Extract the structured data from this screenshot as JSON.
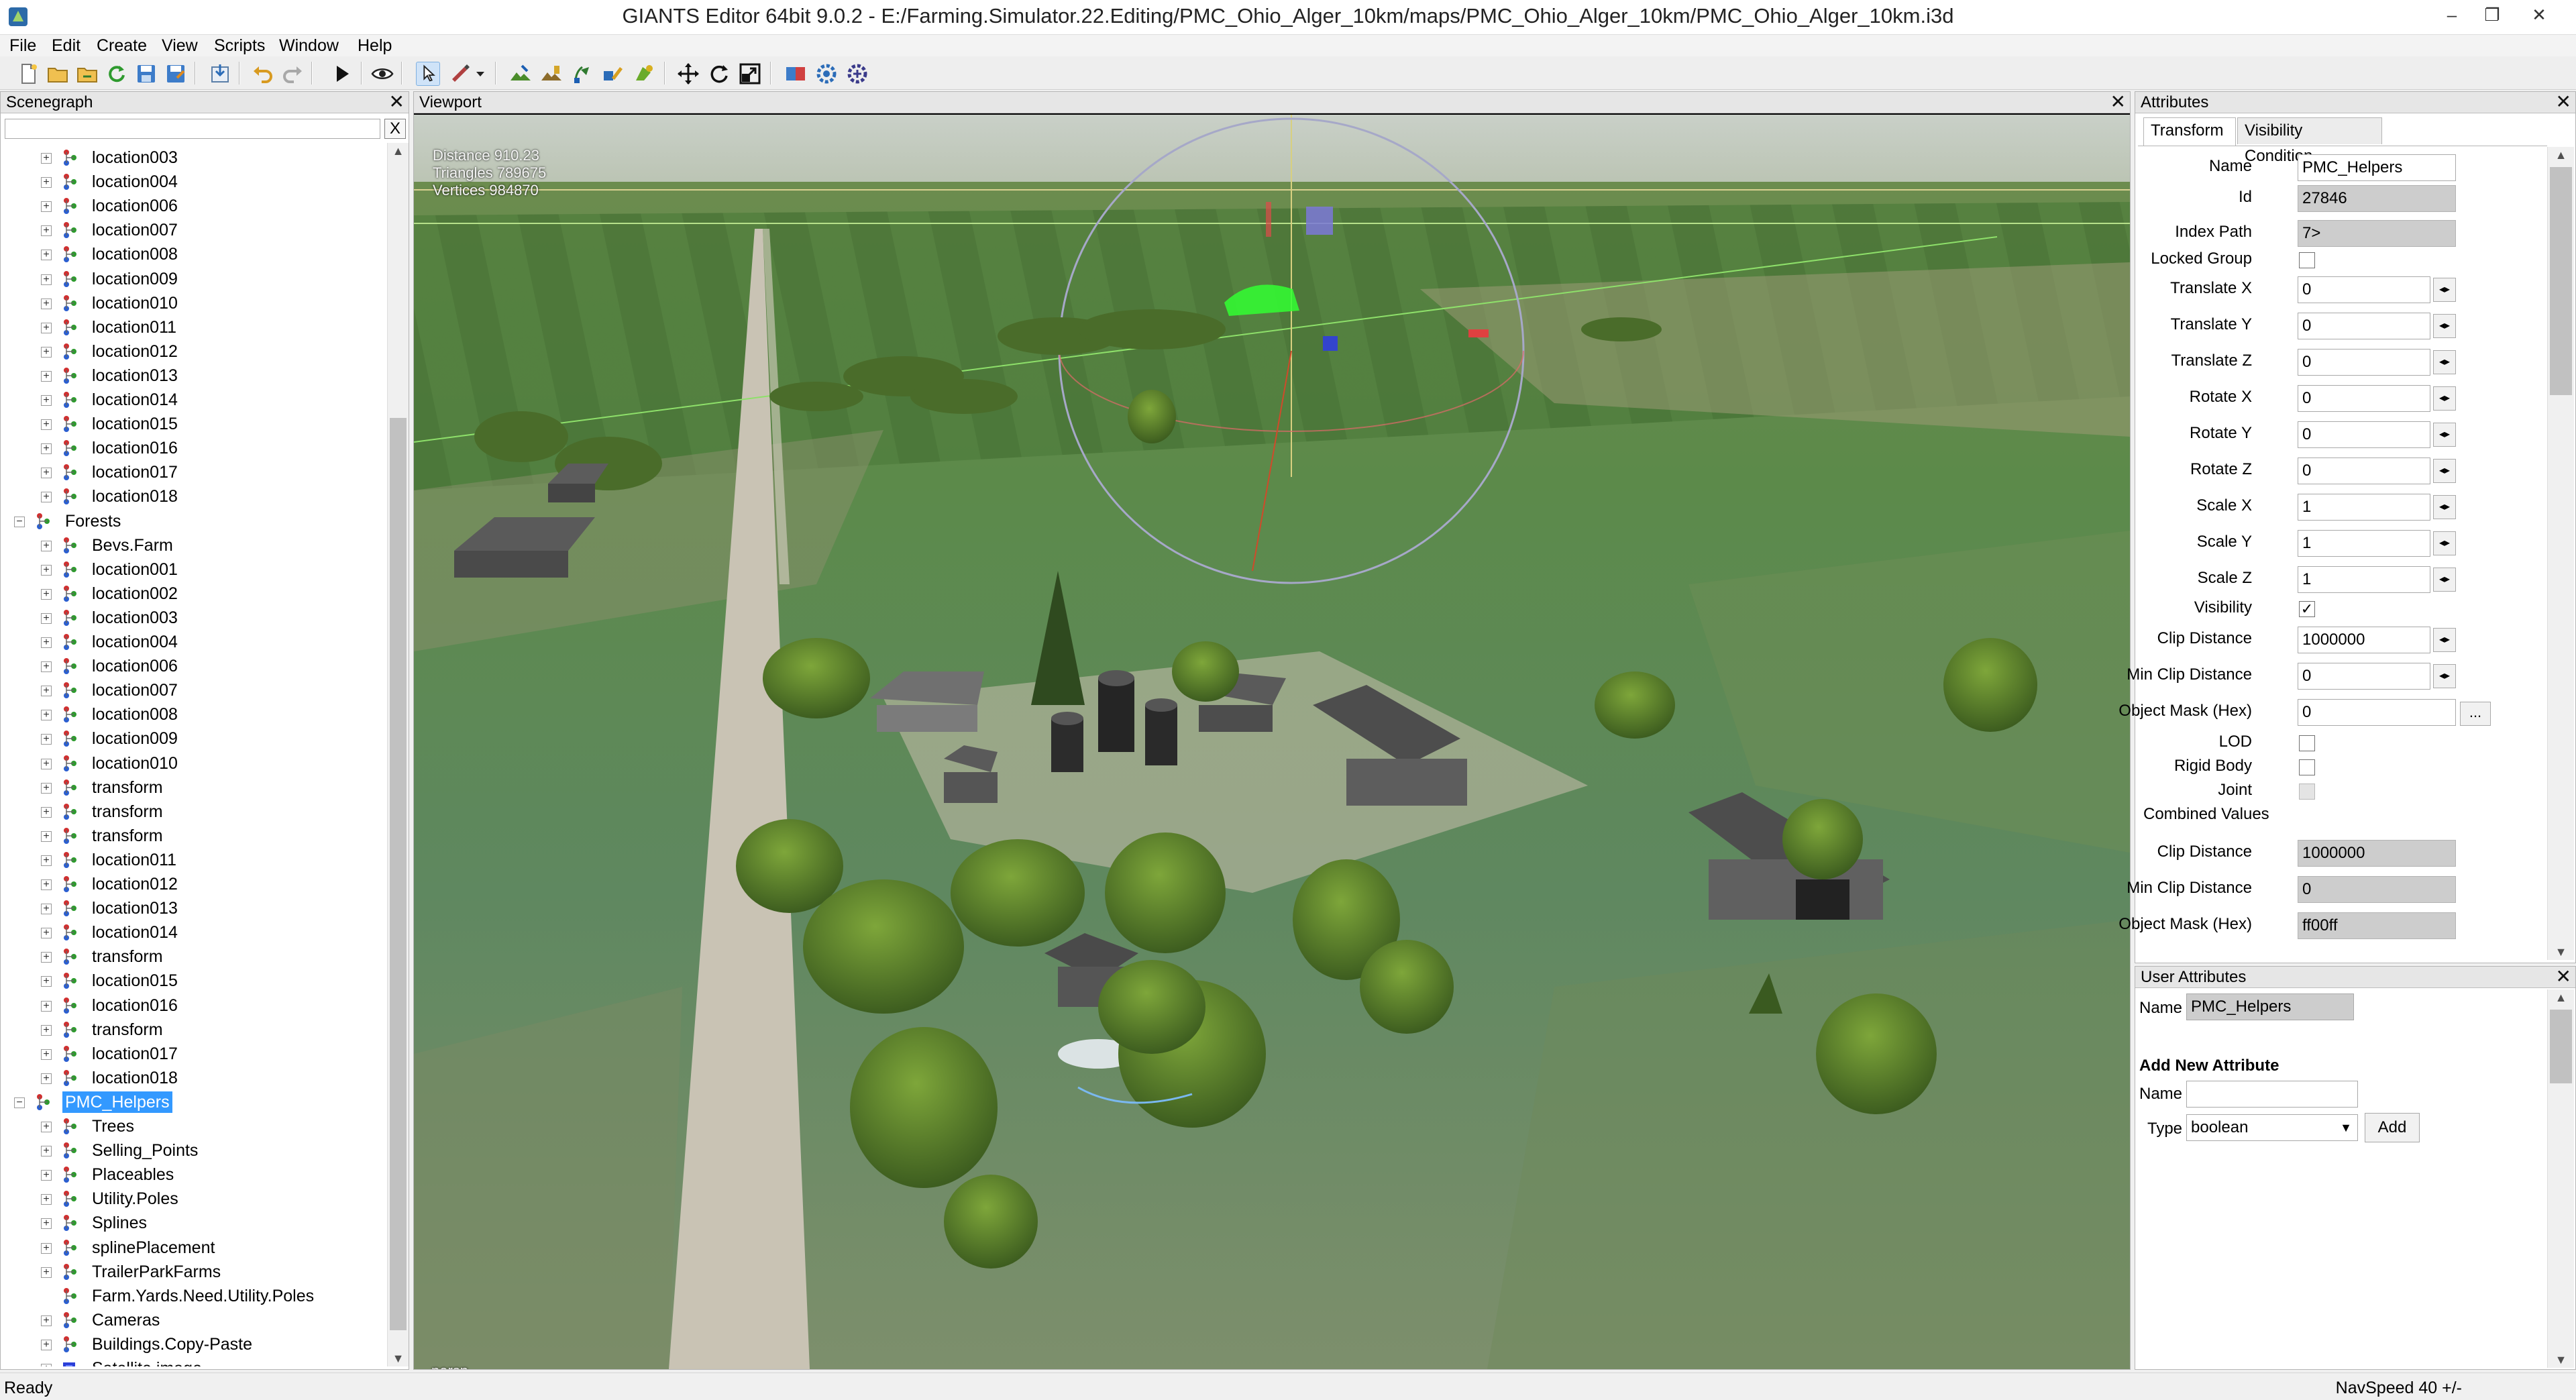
{
  "window": {
    "title": "GIANTS Editor 64bit 9.0.2 - E:/Farming.Simulator.22.Editing/PMC_Ohio_Alger_10km/maps/PMC_Ohio_Alger_10km/PMC_Ohio_Alger_10km.i3d",
    "minimize": "–",
    "maximize": "❐",
    "close": "✕"
  },
  "menu": [
    "File",
    "Edit",
    "Create",
    "View",
    "Scripts",
    "Window",
    "Help"
  ],
  "toolbar_icons": [
    "new-file-icon",
    "open-file-icon",
    "open-recent-icon",
    "reload-icon",
    "save-icon",
    "save-as-icon",
    "import-icon",
    "undo-icon",
    "redo-icon",
    "play-icon",
    "show-hide-icon",
    "select-tool-icon",
    "paint-tool-icon",
    "terrain-sculpt-icon",
    "terrain-paint-icon",
    "foliage-paint-icon",
    "texture-paint-icon",
    "decal-icon",
    "move-icon",
    "rotate-icon",
    "scale-icon",
    "transform-group-icon",
    "settings-icon",
    "tool-options-icon"
  ],
  "scenegraph": {
    "title": "Scenegraph",
    "close": "✕",
    "search_placeholder": "",
    "clear": "X",
    "nodes": [
      {
        "label": "location003",
        "depth": 2,
        "exp": "+",
        "icon": "transform"
      },
      {
        "label": "location004",
        "depth": 2,
        "exp": "+",
        "icon": "transform"
      },
      {
        "label": "location006",
        "depth": 2,
        "exp": "+",
        "icon": "transform"
      },
      {
        "label": "location007",
        "depth": 2,
        "exp": "+",
        "icon": "transform"
      },
      {
        "label": "location008",
        "depth": 2,
        "exp": "+",
        "icon": "transform"
      },
      {
        "label": "location009",
        "depth": 2,
        "exp": "+",
        "icon": "transform"
      },
      {
        "label": "location010",
        "depth": 2,
        "exp": "+",
        "icon": "transform"
      },
      {
        "label": "location011",
        "depth": 2,
        "exp": "+",
        "icon": "transform"
      },
      {
        "label": "location012",
        "depth": 2,
        "exp": "+",
        "icon": "transform"
      },
      {
        "label": "location013",
        "depth": 2,
        "exp": "+",
        "icon": "transform"
      },
      {
        "label": "location014",
        "depth": 2,
        "exp": "+",
        "icon": "transform"
      },
      {
        "label": "location015",
        "depth": 2,
        "exp": "+",
        "icon": "transform"
      },
      {
        "label": "location016",
        "depth": 2,
        "exp": "+",
        "icon": "transform"
      },
      {
        "label": "location017",
        "depth": 2,
        "exp": "+",
        "icon": "transform"
      },
      {
        "label": "location018",
        "depth": 2,
        "exp": "+",
        "icon": "transform"
      },
      {
        "label": "Forests",
        "depth": 1,
        "exp": "−",
        "icon": "transform"
      },
      {
        "label": "Bevs.Farm",
        "depth": 2,
        "exp": "+",
        "icon": "transform"
      },
      {
        "label": "location001",
        "depth": 2,
        "exp": "+",
        "icon": "transform"
      },
      {
        "label": "location002",
        "depth": 2,
        "exp": "+",
        "icon": "transform"
      },
      {
        "label": "location003",
        "depth": 2,
        "exp": "+",
        "icon": "transform"
      },
      {
        "label": "location004",
        "depth": 2,
        "exp": "+",
        "icon": "transform"
      },
      {
        "label": "location006",
        "depth": 2,
        "exp": "+",
        "icon": "transform"
      },
      {
        "label": "location007",
        "depth": 2,
        "exp": "+",
        "icon": "transform"
      },
      {
        "label": "location008",
        "depth": 2,
        "exp": "+",
        "icon": "transform"
      },
      {
        "label": "location009",
        "depth": 2,
        "exp": "+",
        "icon": "transform"
      },
      {
        "label": "location010",
        "depth": 2,
        "exp": "+",
        "icon": "transform"
      },
      {
        "label": "transform",
        "depth": 2,
        "exp": "+",
        "icon": "transform"
      },
      {
        "label": "transform",
        "depth": 2,
        "exp": "+",
        "icon": "transform"
      },
      {
        "label": "transform",
        "depth": 2,
        "exp": "+",
        "icon": "transform"
      },
      {
        "label": "location011",
        "depth": 2,
        "exp": "+",
        "icon": "transform"
      },
      {
        "label": "location012",
        "depth": 2,
        "exp": "+",
        "icon": "transform"
      },
      {
        "label": "location013",
        "depth": 2,
        "exp": "+",
        "icon": "transform"
      },
      {
        "label": "location014",
        "depth": 2,
        "exp": "+",
        "icon": "transform"
      },
      {
        "label": "transform",
        "depth": 2,
        "exp": "+",
        "icon": "transform"
      },
      {
        "label": "location015",
        "depth": 2,
        "exp": "+",
        "icon": "transform"
      },
      {
        "label": "location016",
        "depth": 2,
        "exp": "+",
        "icon": "transform"
      },
      {
        "label": "transform",
        "depth": 2,
        "exp": "+",
        "icon": "transform"
      },
      {
        "label": "location017",
        "depth": 2,
        "exp": "+",
        "icon": "transform"
      },
      {
        "label": "location018",
        "depth": 2,
        "exp": "+",
        "icon": "transform"
      },
      {
        "label": "PMC_Helpers",
        "depth": 1,
        "exp": "−",
        "icon": "transform",
        "selected": true
      },
      {
        "label": "Trees",
        "depth": 2,
        "exp": "+",
        "icon": "transform"
      },
      {
        "label": "Selling_Points",
        "depth": 2,
        "exp": "+",
        "icon": "transform"
      },
      {
        "label": "Placeables",
        "depth": 2,
        "exp": "+",
        "icon": "transform"
      },
      {
        "label": "Utility.Poles",
        "depth": 2,
        "exp": "+",
        "icon": "transform"
      },
      {
        "label": "Splines",
        "depth": 2,
        "exp": "+",
        "icon": "transform"
      },
      {
        "label": "splinePlacement",
        "depth": 2,
        "exp": "+",
        "icon": "transform"
      },
      {
        "label": "TrailerParkFarms",
        "depth": 2,
        "exp": "+",
        "icon": "transform"
      },
      {
        "label": "Farm.Yards.Need.Utility.Poles",
        "depth": 2,
        "exp": "",
        "icon": "transform"
      },
      {
        "label": "Cameras",
        "depth": 2,
        "exp": "+",
        "icon": "transform"
      },
      {
        "label": "Buildings.Copy-Paste",
        "depth": 2,
        "exp": "+",
        "icon": "transform"
      },
      {
        "label": "Satellite.image",
        "depth": 2,
        "exp": "+",
        "icon": "shape"
      }
    ]
  },
  "viewport": {
    "title": "Viewport",
    "close": "✕",
    "stats": {
      "distance": "Distance 910.23",
      "triangles": "Triangles 789675",
      "vertices": "Vertices 984870"
    },
    "camera_mode": "persp"
  },
  "attributes": {
    "title": "Attributes",
    "close": "✕",
    "tabs": [
      "Transform",
      "Visibility Condition"
    ],
    "active_tab": 0,
    "rows": [
      {
        "label": "Name",
        "type": "text",
        "value": "PMC_Helpers"
      },
      {
        "label": "Id",
        "type": "readonly",
        "value": "27846"
      },
      {
        "label": "Index Path",
        "type": "readonly",
        "value": "7>"
      },
      {
        "label": "Locked Group",
        "type": "check",
        "checked": false
      },
      {
        "label": "Translate X",
        "type": "spin",
        "value": "0"
      },
      {
        "label": "Translate Y",
        "type": "spin",
        "value": "0"
      },
      {
        "label": "Translate Z",
        "type": "spin",
        "value": "0"
      },
      {
        "label": "Rotate X",
        "type": "spin",
        "value": "0"
      },
      {
        "label": "Rotate Y",
        "type": "spin",
        "value": "0"
      },
      {
        "label": "Rotate Z",
        "type": "spin",
        "value": "0"
      },
      {
        "label": "Scale X",
        "type": "spin",
        "value": "1"
      },
      {
        "label": "Scale Y",
        "type": "spin",
        "value": "1"
      },
      {
        "label": "Scale Z",
        "type": "spin",
        "value": "1"
      },
      {
        "label": "Visibility",
        "type": "check",
        "checked": true
      },
      {
        "label": "Clip Distance",
        "type": "spin",
        "value": "1000000"
      },
      {
        "label": "Min Clip Distance",
        "type": "spin",
        "value": "0"
      },
      {
        "label": "Object Mask (Hex)",
        "type": "dots",
        "value": "0"
      },
      {
        "label": "LOD",
        "type": "check",
        "checked": false
      },
      {
        "label": "Rigid Body",
        "type": "check",
        "checked": false
      },
      {
        "label": "Joint",
        "type": "check_disabled",
        "checked": false
      },
      {
        "label": "Combined Values",
        "type": "section"
      },
      {
        "label": "Clip Distance",
        "type": "readonly",
        "value": "1000000"
      },
      {
        "label": "Min Clip Distance",
        "type": "readonly",
        "value": "0"
      },
      {
        "label": "Object Mask (Hex)",
        "type": "readonly",
        "value": "ff00ff"
      }
    ]
  },
  "user_attributes": {
    "title": "User Attributes",
    "close": "✕",
    "name_label": "Name",
    "name_value": "PMC_Helpers",
    "add_title": "Add New Attribute",
    "new_name_label": "Name",
    "new_name_value": "",
    "type_label": "Type",
    "type_value": "boolean",
    "add_button": "Add"
  },
  "status": {
    "left": "Ready",
    "right": "NavSpeed 40 +/-"
  }
}
